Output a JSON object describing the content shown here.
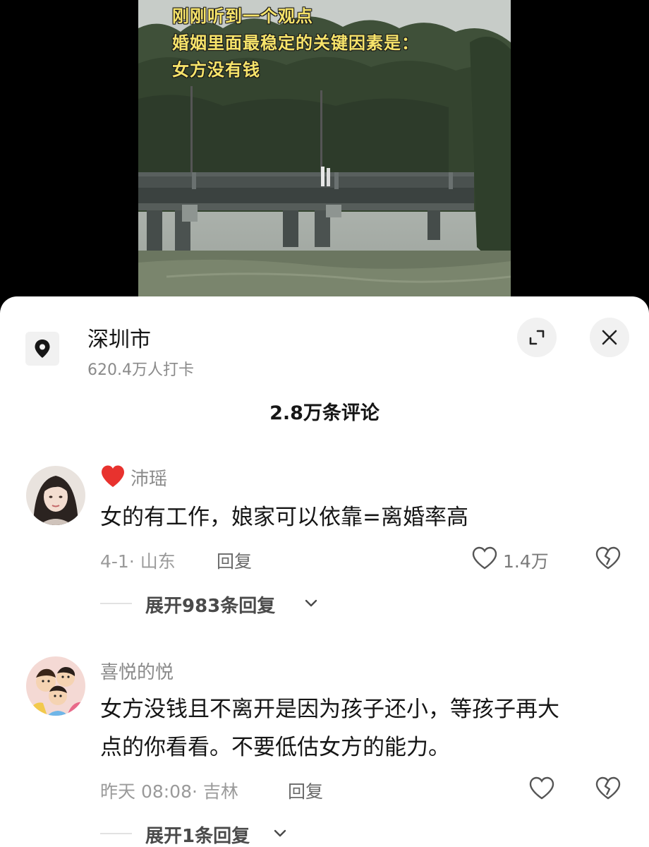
{
  "video": {
    "overlay_lines": [
      "刚刚听到一个观点",
      "婚姻里面最稳定的关键因素是：",
      "女方没有钱"
    ]
  },
  "location": {
    "icon": "location-pin-icon",
    "name": "深圳市",
    "checkins": "620.4万人打卡"
  },
  "header_buttons": {
    "expand_icon": "expand-icon",
    "close_icon": "close-icon"
  },
  "comment_count": "2.8万条评论",
  "comments": [
    {
      "badge_icon": "red-heart-icon",
      "username": "沛瑶",
      "text": "女的有工作，娘家可以依靠=离婚率高",
      "meta": "4-1· 山东",
      "reply_label": "回复",
      "likes": "1.4万",
      "expand_replies": "展开983条回复"
    },
    {
      "username": "喜悦的悦",
      "text_lines": [
        "女方没钱且不离开是因为孩子还小，等孩子再大",
        "点的你看看。不要低估女方的能力。"
      ],
      "meta": "昨天 08:08· 吉林",
      "reply_label": "回复",
      "likes": "",
      "expand_replies": "展开1条回复"
    }
  ],
  "colors": {
    "overlay_text": "#f6e36a",
    "badge_heart": "#e8322e",
    "muted_text": "#8a8a8a"
  }
}
